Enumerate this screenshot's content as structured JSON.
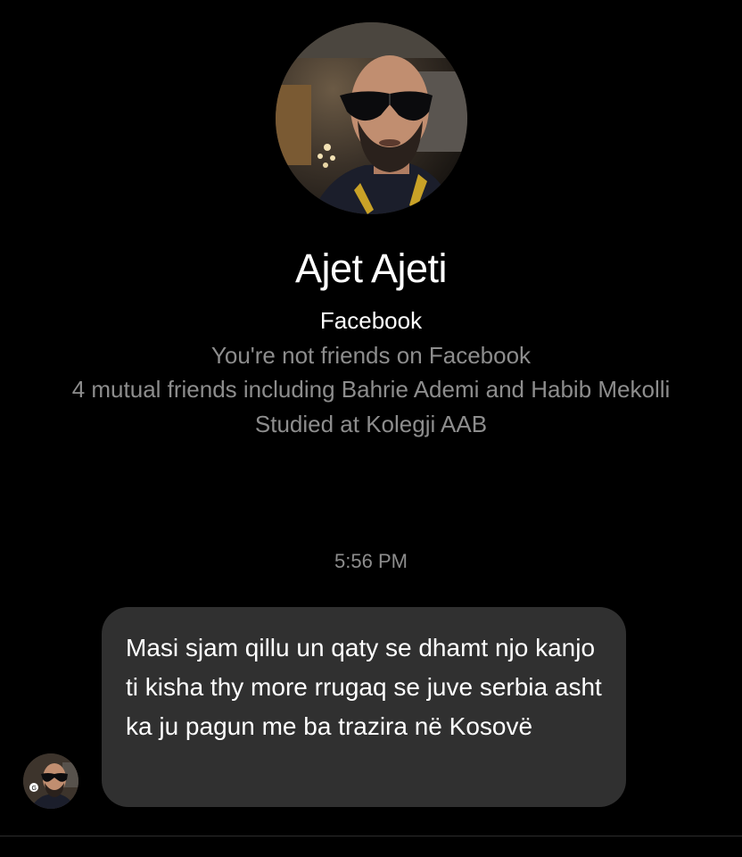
{
  "profile": {
    "name": "Ajet Ajeti",
    "source": "Facebook",
    "friend_status": "You're not friends on Facebook",
    "mutual_friends": "4 mutual friends including Bahrie Ademi and Habib Mekolli",
    "education": "Studied at Kolegji AAB",
    "photo_icon": "profile-photo"
  },
  "conversation": {
    "timestamp": "5:56 PM",
    "messages": [
      {
        "sender": "other",
        "text": "Masi sjam qillu un qaty se dhamt njo kanjo ti kisha thy more rrugaq se juve serbia asht ka ju pagun me ba trazira në Kosovë"
      }
    ]
  },
  "colors": {
    "background": "#000000",
    "primary_text": "#ffffff",
    "secondary_text": "#8d8d8d",
    "bubble": "#303030"
  }
}
